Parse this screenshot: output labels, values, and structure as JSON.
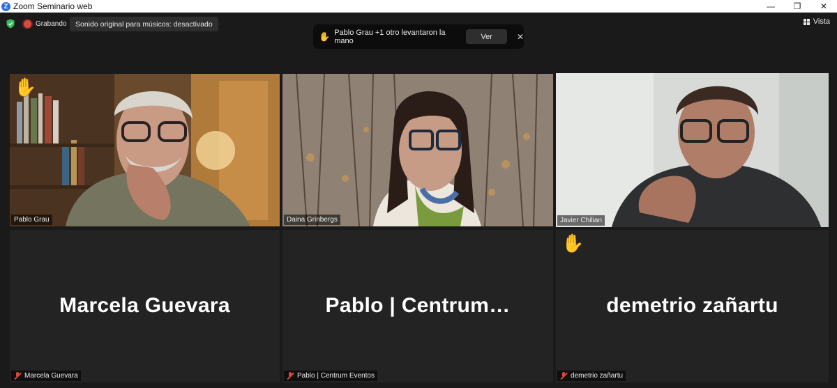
{
  "window": {
    "title": "Zoom Seminario web",
    "controls": [
      "—",
      "❐",
      "✕"
    ]
  },
  "toolbar": {
    "recording_label": "Grabando",
    "sound_status": "Sonido original para músicos: desactivado",
    "view_label": "Vista"
  },
  "notification": {
    "icon": "✋",
    "text": "Pablo Grau +1 otro levantaron la mano",
    "button_label": "Ver",
    "close": "✕"
  },
  "participants": [
    {
      "name": "Pablo Grau",
      "video": true,
      "hand_raised": true,
      "muted": false,
      "active_speaker": false
    },
    {
      "name": "Daina Grinbergs",
      "video": true,
      "hand_raised": false,
      "muted": false,
      "active_speaker": false
    },
    {
      "name": "Javier Chilian",
      "video": true,
      "hand_raised": false,
      "muted": false,
      "active_speaker": true
    },
    {
      "name": "Marcela Guevara",
      "display_name": "Marcela Guevara",
      "video": false,
      "hand_raised": false,
      "muted": true,
      "active_speaker": false
    },
    {
      "name": "Pablo | Centrum Eventos",
      "display_name": "Pablo | Centrum…",
      "video": false,
      "hand_raised": false,
      "muted": true,
      "active_speaker": false
    },
    {
      "name": "demetrio zañartu",
      "display_name": "demetrio zañartu",
      "video": false,
      "hand_raised": true,
      "muted": true,
      "active_speaker": false
    }
  ],
  "icons": {
    "hand": "✋"
  },
  "colors": {
    "active_speaker_border": "#a9cc4a",
    "mute_red": "#e0473b",
    "zoom_blue": "#2d6fe6",
    "shield_green": "#2fbf5a"
  }
}
